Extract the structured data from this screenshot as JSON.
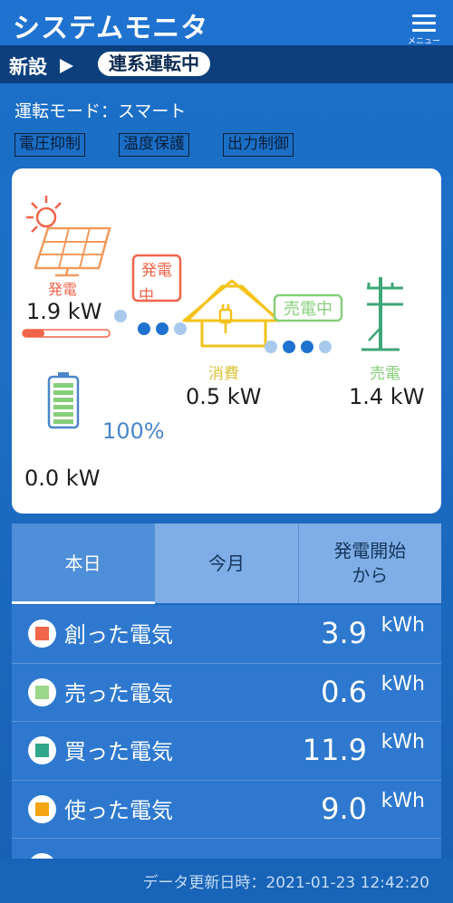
{
  "header": {
    "title": "システムモニタ",
    "menu_label": "メニュー"
  },
  "status": {
    "prefix": "新設",
    "state": "連系運転中"
  },
  "mode": {
    "text": "運転モード：スマート"
  },
  "flags": [
    "電圧抑制",
    "温度保護",
    "出力制御"
  ],
  "flow": {
    "generation": {
      "label": "発電",
      "value": "1.9 kW",
      "level": 0.25,
      "badge": "発電中"
    },
    "consumption": {
      "label": "消費",
      "value": "0.5 kW"
    },
    "grid": {
      "label": "売電",
      "value": "1.4 kW",
      "badge": "売電中"
    },
    "battery": {
      "percent": "100%",
      "value": "0.0 kW",
      "level": 1.0
    },
    "icons": [
      "solar-panel-icon",
      "house-icon",
      "utility-pole-icon",
      "battery-icon"
    ],
    "colors": {
      "generation": "#f0644a",
      "consumption": "#f4c21a",
      "grid": "#86cf7a",
      "pole": "#3da777",
      "battery": "#4a86c8",
      "flow_dot": "#1f72cf"
    }
  },
  "tabs": [
    {
      "label": "本日",
      "active": true
    },
    {
      "label": "今月",
      "active": false
    },
    {
      "label": "発電開始\nから",
      "active": false
    }
  ],
  "summary": [
    {
      "label": "創った電気",
      "value": "3.9",
      "unit": "kWh",
      "color": "#f0644a"
    },
    {
      "label": "売った電気",
      "value": "0.6",
      "unit": "kWh",
      "color": "#9bd88a"
    },
    {
      "label": "買った電気",
      "value": "11.9",
      "unit": "kWh",
      "color": "#2ea78a"
    },
    {
      "label": "使った電気",
      "value": "9.0",
      "unit": "kWh",
      "color": "#f5a414"
    }
  ],
  "footer": {
    "updated": "データ更新日時：2021-01-23 12:42:20"
  }
}
